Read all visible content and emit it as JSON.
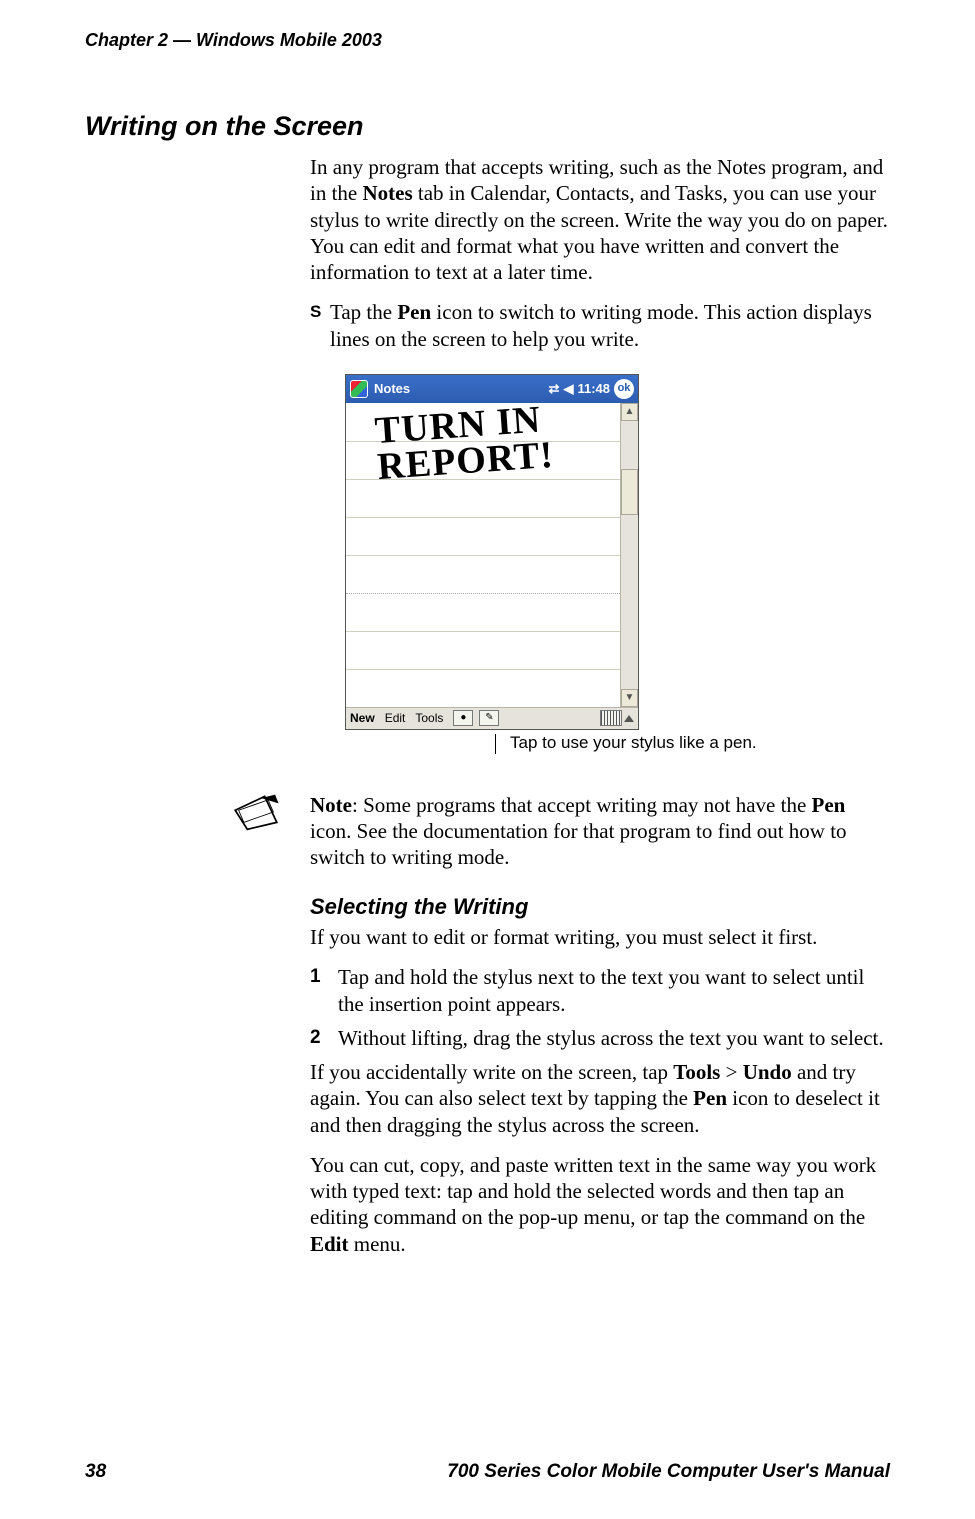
{
  "header": {
    "chapter_label": "Chapter 2",
    "dash": " — ",
    "chapter_title": "Windows Mobile 2003"
  },
  "section": {
    "heading": "Writing on the Screen",
    "intro_pre": "In any program that accepts writing, such as the Notes program, and in the ",
    "intro_bold1": "Notes",
    "intro_post": " tab in Calendar, Contacts, and Tasks, you can use your stylus to write directly on the screen. Write the way you do on paper. You can edit and format what you have written and convert the information to text at a later time.",
    "bullet_pre": "Tap the ",
    "bullet_bold": "Pen",
    "bullet_post": " icon to switch to writing mode. This action displays lines on the screen to help you write."
  },
  "screenshot": {
    "app_title": "Notes",
    "time": "11:48",
    "ok": "ok",
    "menu_new": "New",
    "menu_edit": "Edit",
    "menu_tools": "Tools",
    "handwriting_label": "TURN IN\nREPORT!",
    "caption": "Tap to use your stylus like a pen."
  },
  "note": {
    "label": "Note",
    "text_pre": ": Some programs that accept writing may not have the ",
    "text_bold": "Pen",
    "text_post": " icon. See the documentation for that program to find out how to switch to writing mode."
  },
  "selecting": {
    "heading": "Selecting the Writing",
    "intro": "If you want to edit or format writing, you must select it first.",
    "step1_num": "1",
    "step1": "Tap and hold the stylus next to the text you want to select until the insertion point appears.",
    "step2_num": "2",
    "step2": "Without lifting, drag the stylus across the text you want to select.",
    "accident_pre": "If you accidentally write on the screen, tap ",
    "accident_b1": "Tools",
    "accident_gt": " > ",
    "accident_b2": "Undo",
    "accident_mid": " and try again. You can also select text by tapping the ",
    "accident_b3": "Pen",
    "accident_post": " icon to deselect it and then dragging the stylus across the screen.",
    "cut_pre": "You can cut, copy, and paste written text in the same way you work with typed text: tap and hold the selected words and then tap an editing command on the pop-up menu, or tap the command on the ",
    "cut_b": "Edit",
    "cut_post": " menu."
  },
  "footer": {
    "page_no": "38",
    "manual": "700 Series Color Mobile Computer User's Manual"
  }
}
